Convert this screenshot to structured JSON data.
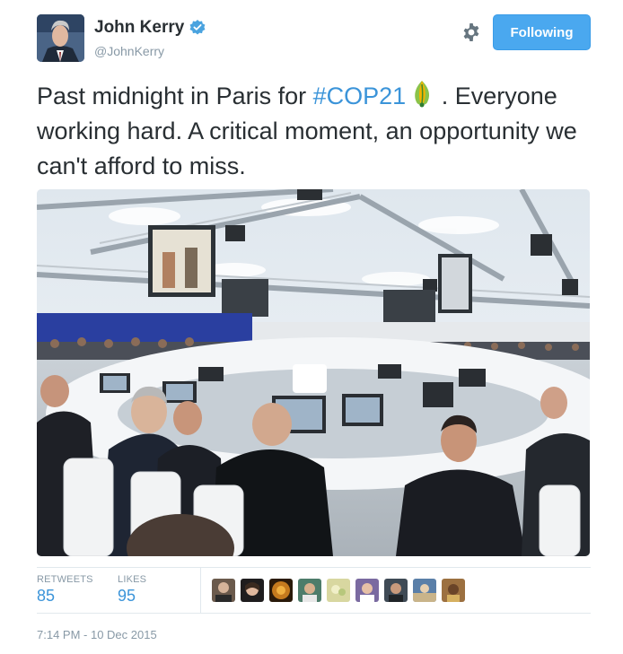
{
  "author": {
    "name": "John Kerry",
    "handle": "@JohnKerry",
    "verified": true
  },
  "follow_button": {
    "label": "Following",
    "color": "#4aa8ef"
  },
  "tweet": {
    "text_part1": "Past midnight in Paris for ",
    "hashtag": "#COP21",
    "text_part2": " . Everyone working hard. A critical moment, an opportunity we can't afford to miss."
  },
  "media": {
    "description": "conference hall photo"
  },
  "stats": {
    "retweets_label": "RETWEETS",
    "retweets": "85",
    "likes_label": "LIKES",
    "likes": "95"
  },
  "likers": [
    {
      "color": "#6b5a4c"
    },
    {
      "color": "#8a6c58"
    },
    {
      "color": "#c47a1e"
    },
    {
      "color": "#4d7c6a"
    },
    {
      "color": "#d8d7a0"
    },
    {
      "color": "#7a6aa0"
    },
    {
      "color": "#3f4a55"
    },
    {
      "color": "#5a7fa8"
    },
    {
      "color": "#9c7040"
    }
  ],
  "timestamp": "7:14 PM - 10 Dec 2015",
  "colors": {
    "link": "#3b94d9",
    "muted": "#8899a6",
    "text": "#292f33"
  }
}
